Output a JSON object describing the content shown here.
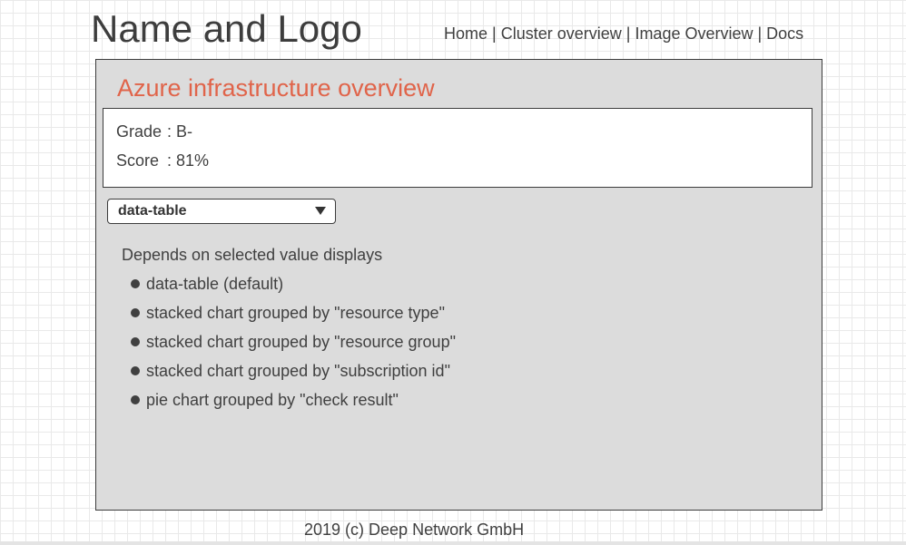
{
  "header": {
    "title": "Name and Logo",
    "nav": [
      {
        "label": "Home"
      },
      {
        "label": "Cluster overview"
      },
      {
        "label": "Image Overview"
      },
      {
        "label": "Docs"
      }
    ],
    "nav_separator": "|"
  },
  "panel": {
    "title": "Azure infrastructure overview",
    "grade": {
      "label": "Grade",
      "separator": ": ",
      "value": "B-"
    },
    "score": {
      "label": "Score",
      "separator": ": ",
      "value": "81%"
    },
    "dropdown": {
      "selected": "data-table"
    },
    "description": "Depends on selected value displays",
    "options": [
      "data-table (default)",
      "stacked chart grouped by \"resource type\"",
      "stacked chart grouped by \"resource group\"",
      "stacked chart grouped by \"subscription id\"",
      "pie chart grouped by \"check result\""
    ]
  },
  "footer": {
    "text": "2019 (c) Deep Network GmbH"
  },
  "colors": {
    "accent_title": "#e0644a",
    "panel_background": "#dcdcdc",
    "text": "#404040"
  }
}
